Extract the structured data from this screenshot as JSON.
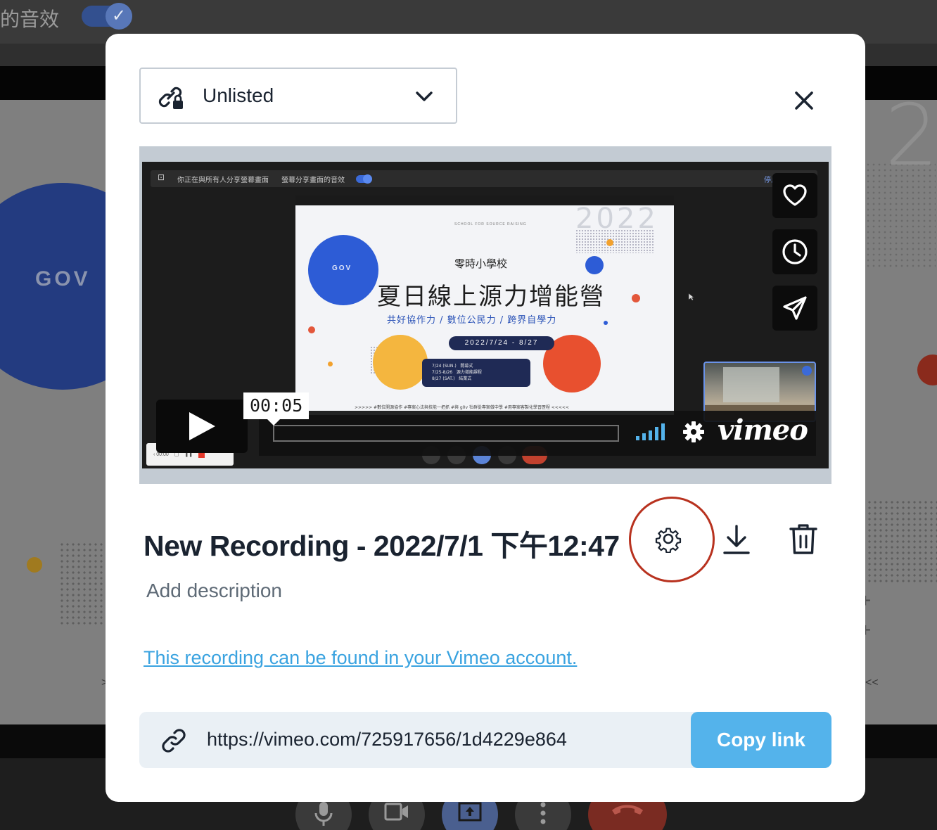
{
  "background": {
    "toggle_label": "的音效",
    "slide_logo_text": "GOV",
    "slide_year_digit": "2"
  },
  "modal": {
    "privacy": {
      "selected": "Unlisted",
      "icon": "link-lock-icon"
    },
    "close_icon": "close-icon",
    "player": {
      "timecode": "00:05",
      "brand": "vimeo",
      "side_buttons": [
        "heart-icon",
        "clock-icon",
        "send-icon"
      ],
      "video_frame": {
        "share_notice": "你正在與所有人分享螢幕畫面",
        "share_audio": "螢幕分享畫面的音效",
        "stop_label": "停止分享",
        "slide_year": "2022",
        "slide_logo": "GOV",
        "slide_school": "零時小學校",
        "slide_title": "夏日線上源力增能營",
        "slide_subtitle": "共好協作力 / 數位公民力 / 跨界自學力",
        "slide_date": "2022/7/24 - 8/27",
        "slide_schedule": "7/24 (SUN.)   開幕式\n7/25-8/26   源力增能課程\n8/27 (SAT.)   結業式",
        "slide_footer": ">>>>> #數位開源協作 #專案心法與技能一把抓 #與 g0v 社群從專案做中學 #用專案客製化學習歷程 <<<<<"
      }
    },
    "recording_title": "New Recording - 2022/7/1 下午12:47",
    "actions": {
      "settings_icon": "gear-icon",
      "download_icon": "download-icon",
      "delete_icon": "trash-icon"
    },
    "description_placeholder": "Add description",
    "account_link": "This recording can be found in your Vimeo account.",
    "share": {
      "url": "https://vimeo.com/725917656/1d4229e864",
      "copy_label": "Copy link"
    }
  },
  "colors": {
    "accent": "#54b3eb",
    "link": "#3aa3e0",
    "highlight_ring": "#b8321f",
    "text_dark": "#1a2330"
  }
}
